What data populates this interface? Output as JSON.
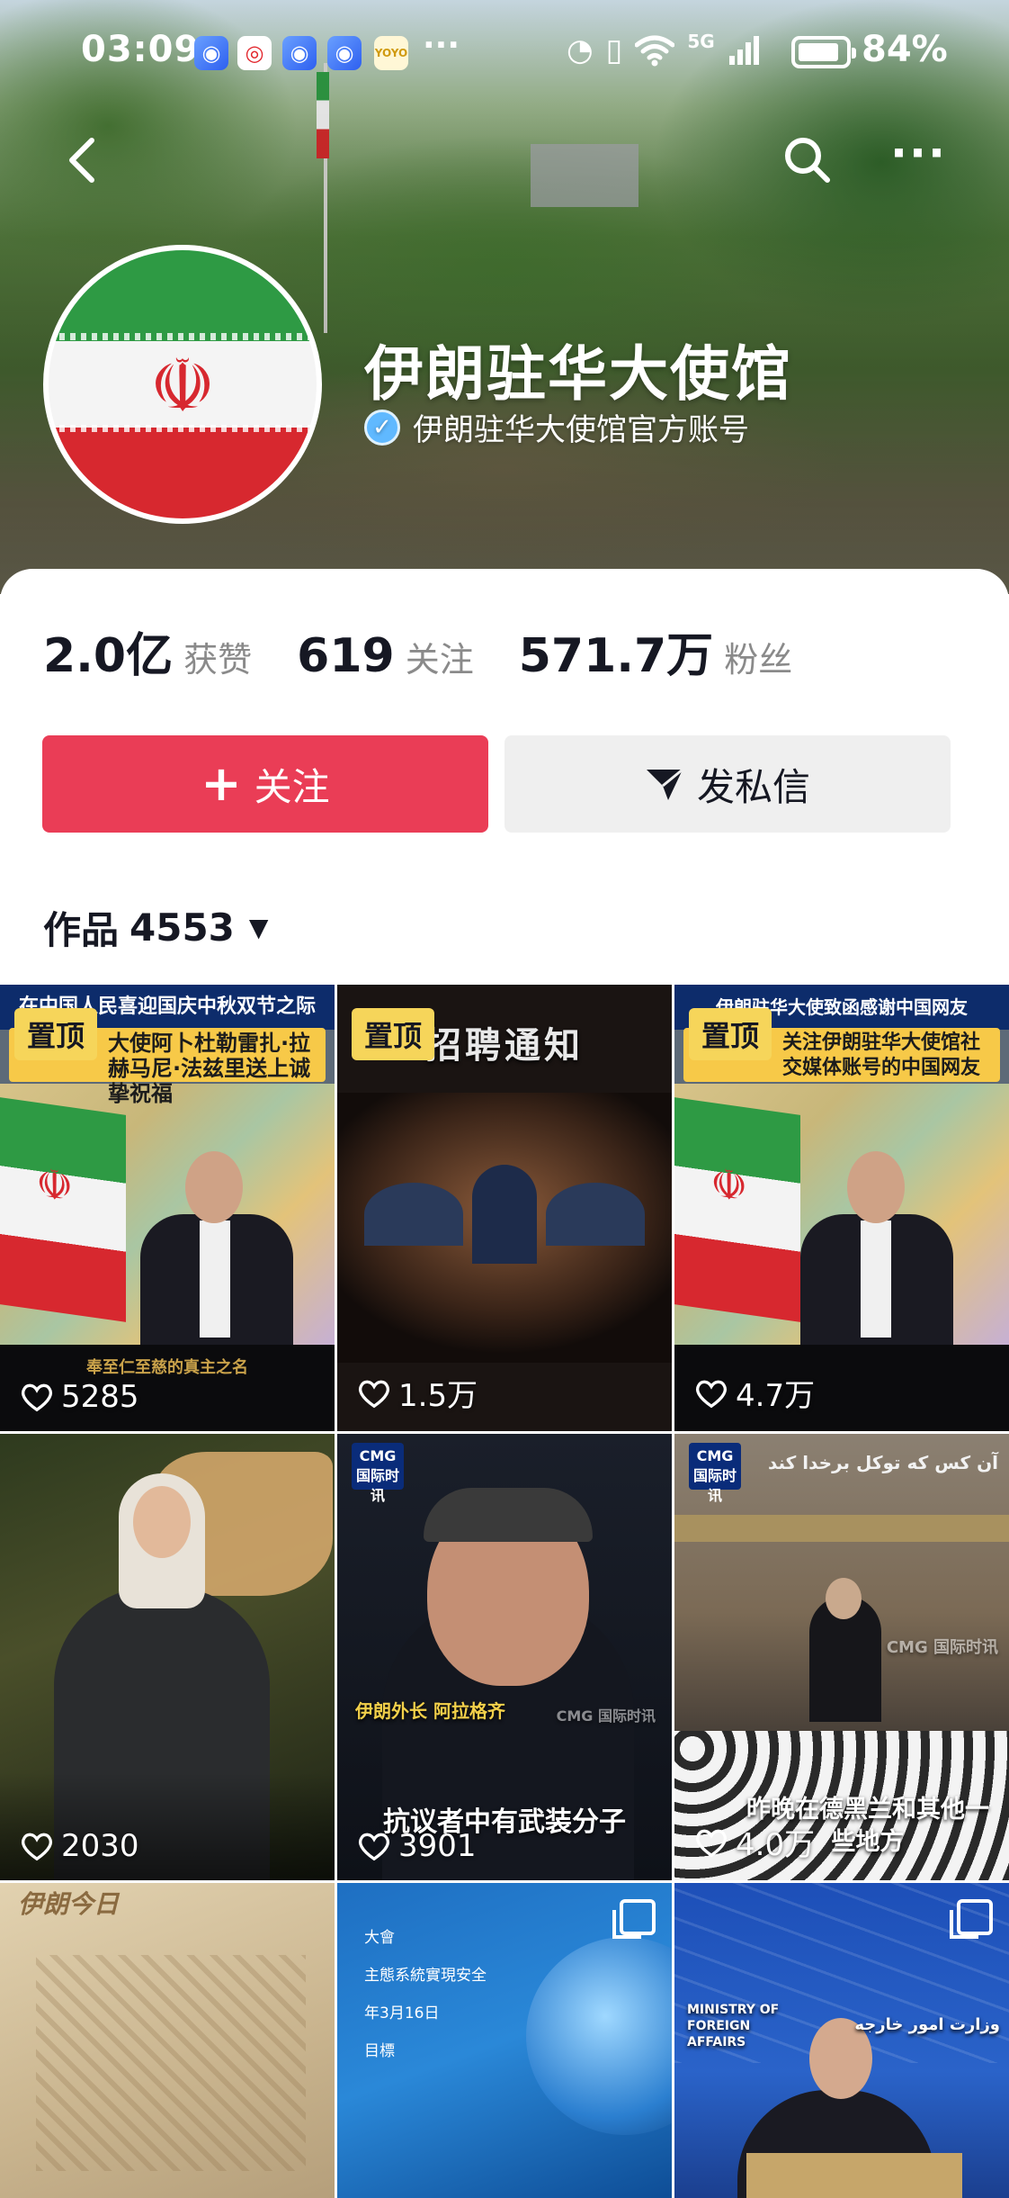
{
  "status_bar": {
    "time": "03:09",
    "dots": "···",
    "network": "5G",
    "battery_percent": 84,
    "battery_text": "84%",
    "icons": [
      "blue-app-icon",
      "weibo-icon",
      "blue-app-icon",
      "blue-app-icon",
      "yoyo-icon",
      "alarm-icon",
      "vibrate-icon",
      "wifi-icon",
      "signal-icon",
      "battery-icon"
    ]
  },
  "nav": {
    "back_icon": "chevron-left-icon",
    "search_icon": "search-icon",
    "more_label": "···"
  },
  "profile": {
    "name": "伊朗驻华大使馆",
    "verified_label": "伊朗驻华大使馆官方账号",
    "avatar_emblem": "☫"
  },
  "stats": [
    {
      "value": "2.0亿",
      "label": "获赞"
    },
    {
      "value": "619",
      "label": "关注"
    },
    {
      "value": "571.7万",
      "label": "粉丝"
    }
  ],
  "actions": {
    "follow_icon": "+",
    "follow_label": "关注",
    "message_label": "发私信"
  },
  "works": {
    "label": "作品",
    "count": "4553",
    "caret": "▼"
  },
  "grid": [
    {
      "pinned": "置顶",
      "likes": "5285",
      "top_text": "在中国人民喜迎国庆中秋双节之际",
      "banner": "大使阿卜杜勒雷扎·拉赫马尼·法兹里送上诚挚祝福",
      "subtitle": "奉至仁至慈的真主之名"
    },
    {
      "pinned": "置顶",
      "likes": "1.5万",
      "headline": "招聘通知"
    },
    {
      "pinned": "置顶",
      "likes": "4.7万",
      "top_text": "伊朗驻华大使致函感谢中国网友",
      "banner": "关注伊朗驻华大使馆社交媒体账号的中国网友"
    },
    {
      "likes": "2030"
    },
    {
      "likes": "3901",
      "logo": "CMG 国际时讯",
      "name_tag": "伊朗外长 阿拉格齐",
      "caption": "抗议者中有武装分子",
      "watermark": "CMG 国际时讯"
    },
    {
      "likes": "4.0万",
      "logo": "CMG 国际时讯",
      "arabic": "آن کس که توکل برخدا کند",
      "caption": "昨晚在德黑兰和其他一些地方",
      "watermark": "CMG 国际时讯"
    },
    {
      "title_script": "伊朗今日"
    },
    {
      "lines": [
        "大會",
        "主態系統實現安全",
        "年3月16日",
        "目標"
      ]
    },
    {
      "sign_en": "MINISTRY OF FOREIGN AFFAIRS",
      "sign_fa": "وزارت امور خارجه"
    }
  ],
  "colors": {
    "follow_button": "#ea3d56",
    "message_button": "#efefef",
    "pin_badge": "#f6d55a",
    "stat_number": "#161823",
    "stat_label": "#8a8a8a"
  }
}
